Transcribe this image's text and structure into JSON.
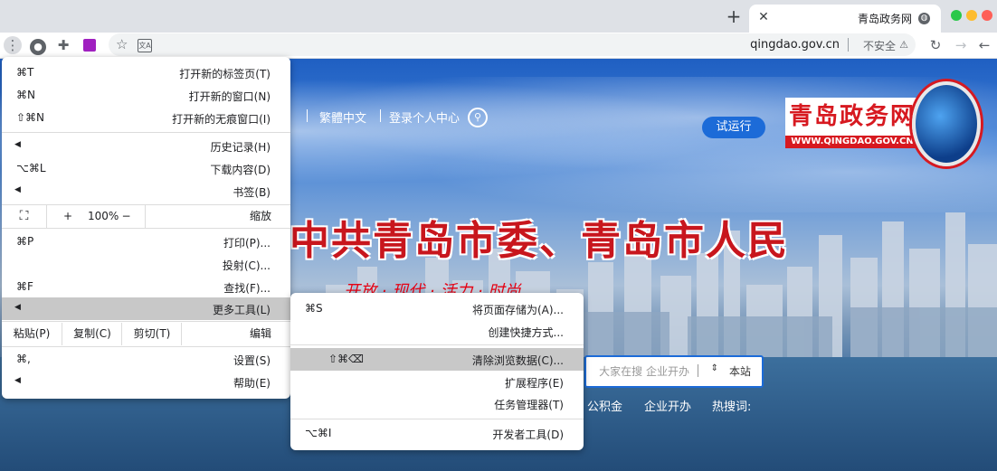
{
  "browser": {
    "tab_title": "青岛政务网",
    "new_tab_symbol": "+",
    "close_symbol": "✕",
    "url": "qingdao.gov.cn",
    "security_label": "不安全",
    "security_icon": "⚠",
    "icons": {
      "back": "back-arrow-icon",
      "forward": "forward-arrow-icon",
      "reload": "reload-icon",
      "bookmark": "star-icon",
      "translate": "translate-icon",
      "extensions": "puzzle-icon",
      "profile": "profile-icon",
      "menu": "kebab-menu-icon"
    }
  },
  "site": {
    "logo_title": "青岛政务网",
    "logo_url": "WWW.QINGDAO.GOV.CN",
    "trial_button": "试运行",
    "login_link": "登录个人中心",
    "traditional_link": "繁體中文",
    "headline": "中共青岛市委、青岛市人民",
    "slogan": "开放 · 现代 · 活力 · 时尚",
    "search_scope": "本站",
    "search_placeholder": "大家在搜 企业开办",
    "hot_label": "热搜词:",
    "hot_terms": [
      "企业开办",
      "公积金"
    ]
  },
  "main_menu": {
    "new_tab": {
      "label": "打开新的标签页(T)",
      "shortcut": "⌘T"
    },
    "new_window": {
      "label": "打开新的窗口(N)",
      "shortcut": "⌘N"
    },
    "new_incognito": {
      "label": "打开新的无痕窗口(I)",
      "shortcut": "⇧⌘N"
    },
    "history": {
      "label": "历史记录(H)"
    },
    "downloads": {
      "label": "下载内容(D)",
      "shortcut": "⌥⌘L"
    },
    "bookmarks": {
      "label": "书签(B)"
    },
    "zoom": {
      "label": "缩放",
      "minus": "−",
      "value": "100%",
      "plus": "+",
      "fullscreen": "⛶"
    },
    "print": {
      "label": "打印(P)...",
      "shortcut": "⌘P"
    },
    "cast": {
      "label": "投射(C)..."
    },
    "find": {
      "label": "查找(F)...",
      "shortcut": "⌘F"
    },
    "more_tools": {
      "label": "更多工具(L)"
    },
    "edit": {
      "label": "编辑",
      "cut": "剪切(T)",
      "copy": "复制(C)",
      "paste": "粘贴(P)"
    },
    "settings": {
      "label": "设置(S)",
      "shortcut": "⌘,"
    },
    "help": {
      "label": "帮助(E)"
    }
  },
  "submenu": {
    "save_page": {
      "label": "将页面存储为(A)...",
      "shortcut": "⌘S"
    },
    "create_shortcut": {
      "label": "创建快捷方式..."
    },
    "clear_data": {
      "label": "清除浏览数据(C)...",
      "shortcut": "⇧⌘⌫"
    },
    "extensions": {
      "label": "扩展程序(E)"
    },
    "task_manager": {
      "label": "任务管理器(T)"
    },
    "dev_tools": {
      "label": "开发者工具(D)",
      "shortcut": "⌥⌘I"
    }
  },
  "colors": {
    "highlight": "#c8c8c8",
    "brand_red": "#d71920",
    "brand_blue": "#1c6bd8"
  }
}
